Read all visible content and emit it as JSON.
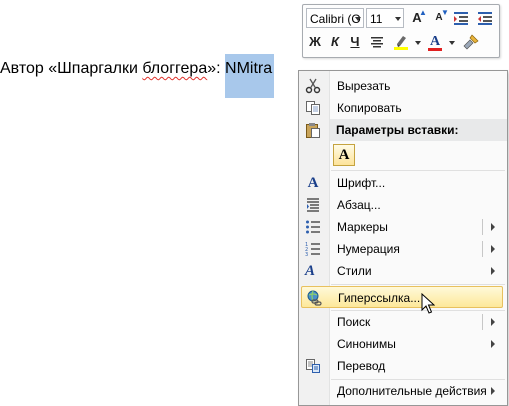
{
  "document": {
    "text_before": "Автор «Шпаргалки ",
    "text_misspelled": "блоггера",
    "text_after": "»: ",
    "selected_text": "NMitra"
  },
  "mini_toolbar": {
    "font_name": "Calibri (О",
    "font_size": "11",
    "bold": "Ж",
    "italic": "К",
    "underline": "Ч",
    "grow_font": "A",
    "shrink_font": "A",
    "font_color": "A",
    "highlight_color": "#ffff00",
    "font_color_value": "#e02020"
  },
  "context_menu": {
    "cut": "Вырезать",
    "copy": "Копировать",
    "paste_options_header": "Параметры вставки:",
    "paste_keep_text": "A",
    "font": "Шрифт...",
    "paragraph": "Абзац...",
    "bullets": "Маркеры",
    "numbering": "Нумерация",
    "styles": "Стили",
    "hyperlink": "Гиперссылка...",
    "search": "Поиск",
    "synonyms": "Синонимы",
    "translate": "Перевод",
    "more_actions": "Дополнительные действия"
  }
}
